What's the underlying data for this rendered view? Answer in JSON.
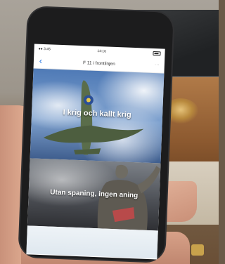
{
  "status_bar": {
    "time_left": "●● 3:45",
    "time_center": "14:16"
  },
  "nav": {
    "back_icon": "chevron-left-icon",
    "title": "F 11 i frontlinjen",
    "menu_icon": "more-icon"
  },
  "cards": [
    {
      "title": "I krig och kallt krig",
      "image": "spitfire-aircraft"
    },
    {
      "title": "Utan spaning, ingen aning",
      "image": "soldier-statue"
    },
    {
      "title": "",
      "image": "sky-clouds"
    }
  ],
  "colors": {
    "accent": "#2a7ae2",
    "sky": "#4f7ab6",
    "plane": "#5a6d4a"
  }
}
